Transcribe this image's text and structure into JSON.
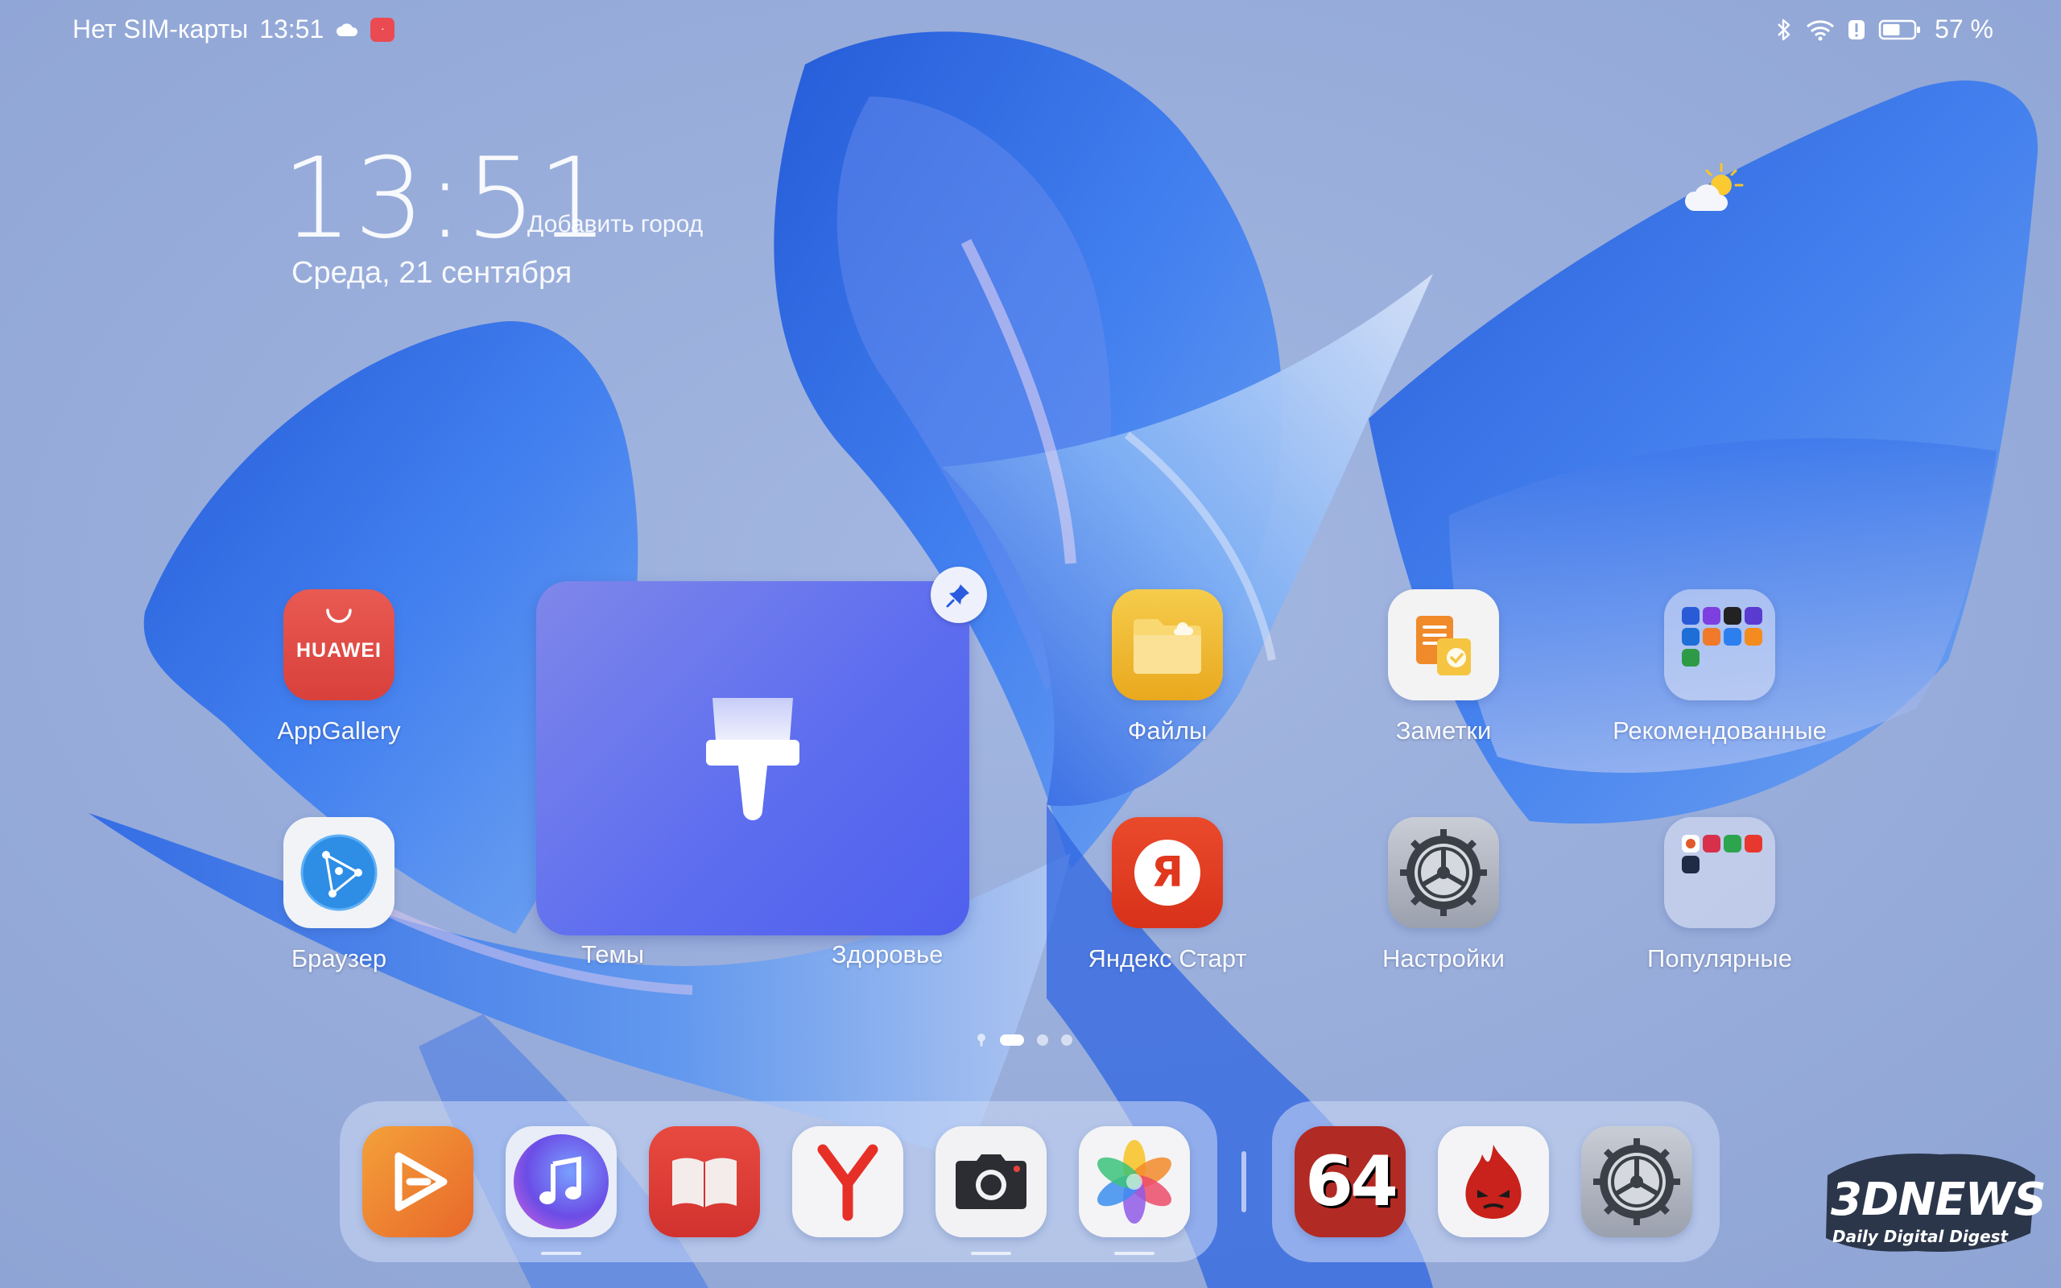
{
  "status_bar": {
    "carrier": "Нет SIM-карты",
    "time": "13:51",
    "battery_percent": "57 %",
    "battery_level": 0.57
  },
  "clock_widget": {
    "time": "13:51",
    "add_city": "Добавить город",
    "date": "Среда, 21 сентября"
  },
  "home_apps": [
    {
      "label": "AppGallery",
      "icon": "appgallery-icon",
      "brand_text": "HUAWEI"
    },
    {
      "label": "Файлы",
      "icon": "files-icon"
    },
    {
      "label": "Заметки",
      "icon": "notes-icon"
    },
    {
      "label": "Рекомендованные",
      "icon": "folder-icon"
    },
    {
      "label": "Браузер",
      "icon": "browser-icon"
    },
    {
      "label": "Яндекс Старт",
      "icon": "yandex-start-icon",
      "glyph": "Я"
    },
    {
      "label": "Настройки",
      "icon": "settings-icon"
    },
    {
      "label": "Популярные",
      "icon": "folder-icon"
    }
  ],
  "widget": {
    "label_left": "Темы",
    "label_right": "Здоровье",
    "icon": "paintbrush-icon"
  },
  "pager": {
    "pages": 3,
    "current": 1
  },
  "dock": {
    "apps": [
      "video-icon",
      "music-icon",
      "books-icon",
      "yandex-browser-icon",
      "camera-icon",
      "gallery-icon"
    ],
    "recent": [
      "aida64-icon",
      "antutu-icon",
      "settings-icon"
    ],
    "aida_text": "64"
  },
  "watermark": {
    "main": "3DNEWS",
    "sub": "Daily Digital Digest"
  },
  "colors": {
    "appgallery": "#e04a44",
    "files": "#f0b930",
    "notes": "#f2f2f2",
    "yandex": "#e0371e",
    "themes_widget": "#5e6eef"
  }
}
